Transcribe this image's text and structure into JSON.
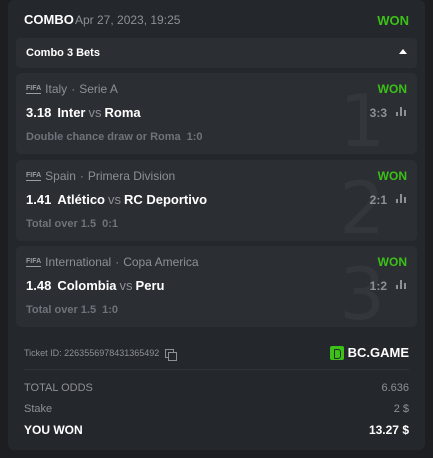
{
  "header": {
    "title": "COMBO",
    "date": "Apr 27, 2023, 19:25",
    "status": "WON"
  },
  "bets_bar": {
    "label": "Combo 3 Bets"
  },
  "bets": [
    {
      "league_icon": "FIFA",
      "country": "Italy",
      "league": "Serie A",
      "status": "WON",
      "odds": "3.18",
      "home": "Inter",
      "vs": "vs",
      "away": "Roma",
      "score": "3:3",
      "market": "Double chance draw or Roma",
      "market_val": "1:0",
      "index": "1"
    },
    {
      "league_icon": "FIFA",
      "country": "Spain",
      "league": "Primera Division",
      "status": "WON",
      "odds": "1.41",
      "home": "Atlético",
      "vs": "vs",
      "away": "RC Deportivo",
      "score": "2:1",
      "market": "Total over 1.5",
      "market_val": "0:1",
      "index": "2"
    },
    {
      "league_icon": "FIFA",
      "country": "International",
      "league": "Copa America",
      "status": "WON",
      "odds": "1.48",
      "home": "Colombia",
      "vs": "vs",
      "away": "Peru",
      "score": "1:2",
      "market": "Total over 1.5",
      "market_val": "1:0",
      "index": "3"
    }
  ],
  "ticket": {
    "id": "Ticket ID: 2263556978431365492",
    "brand": "BC.GAME"
  },
  "summary": {
    "total_odds_label": "TOTAL ODDS",
    "total_odds": "6.636",
    "stake_label": "Stake",
    "stake": "2 $",
    "won_label": "YOU WON",
    "won": "13.27 $"
  },
  "colors": {
    "accent": "#3bc117",
    "card": "#24272b",
    "panel": "#2b2e33"
  },
  "icons": {
    "stats": "stats-bars-icon",
    "copy": "copy-icon",
    "collapse": "caret-up-icon",
    "league": "fifa-icon"
  }
}
